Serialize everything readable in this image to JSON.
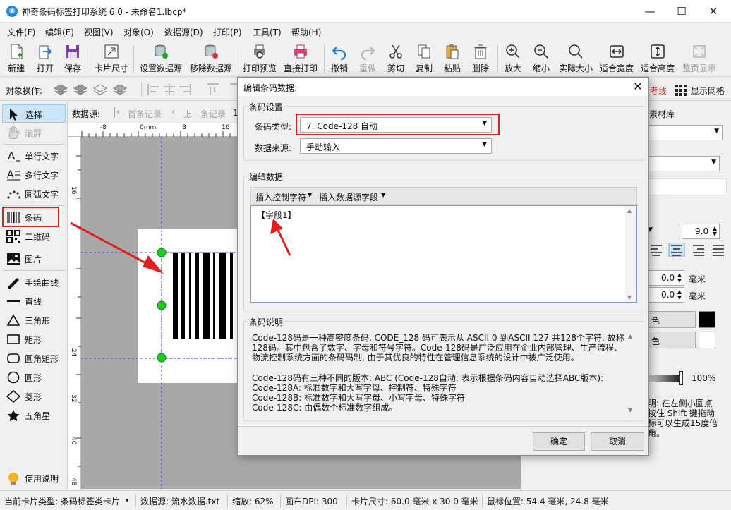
{
  "window": {
    "title": "神奇条码标签打印系统 6.0 - 未命名1.lbcp*",
    "app_icon": "app-logo-icon"
  },
  "menu": [
    "文件(F)",
    "编辑(E)",
    "视图(V)",
    "对象(O)",
    "数据源(D)",
    "打印(P)",
    "工具(T)",
    "帮助(H)"
  ],
  "toolbar": {
    "new": "新建",
    "open": "打开",
    "save": "保存",
    "card_size": "卡片尺寸",
    "set_ds": "设置数据源",
    "remove_ds": "移除数据源",
    "preview": "打印预览",
    "print": "直接打印",
    "undo": "撤销",
    "redo": "重做",
    "cut": "剪切",
    "copy": "复制",
    "paste": "粘贴",
    "delete": "删除",
    "zoom_in": "放大",
    "zoom_out": "缩小",
    "actual": "实际大小",
    "fit_width": "适合宽度",
    "fit_height": "适合高度",
    "fit_page": "整页显示"
  },
  "objbar": {
    "label": "对象操作:",
    "ref_line": "考线",
    "grid": "显示网格"
  },
  "docbar": {
    "ds_label": "数据源:",
    "first": "首条记录",
    "prev": "上一条记录",
    "num": "1"
  },
  "ruler": {
    "h": [
      "-8",
      "0mm",
      "8",
      "16"
    ],
    "v": [
      "16",
      "24",
      "32",
      "40",
      "48"
    ]
  },
  "tools": [
    "选择",
    "滚屏",
    "单行文字",
    "多行文字",
    "圆弧文字",
    "条码",
    "二维码",
    "图片",
    "手绘曲线",
    "直线",
    "三角形",
    "矩形",
    "圆角矩形",
    "圆形",
    "菱形",
    "五角星",
    "使用说明"
  ],
  "right": {
    "tab": "素材库",
    "font_size": "9.0",
    "val1": "0.0",
    "val2": "0.0",
    "unit": "毫米",
    "color_btn": "色",
    "percent": "100%",
    "tip": [
      "明: 在左侧小圆点",
      "按住 Shift 键拖动",
      "标可以生成15度倍",
      "角。"
    ]
  },
  "status": {
    "card_type": "当前卡片类型: 条码标签类卡片",
    "datasource": "数据源: 流水数据.txt",
    "zoom": "缩放: 62%",
    "dpi": "画布DPI: 300",
    "size": "卡片尺寸: 60.0 毫米 x 30.0 毫米",
    "mouse": "鼠标位置: 54.4 毫米, 24.8 毫米"
  },
  "dialog": {
    "title": "编辑条码数据:",
    "settings_label": "条码设置",
    "type_label": "条码类型:",
    "type_value": "7. Code-128 自动",
    "source_label": "数据来源:",
    "source_value": "手动输入",
    "edit_label": "编辑数据",
    "insert_ctrl": "插入控制字符",
    "insert_field": "插入数据源字段",
    "data_value": "【字段1】",
    "desc_label": "条码说明",
    "desc": [
      "Code-128码是一种高密度条码, CODE_128 码可表示从 ASCII 0 到ASCII 127 共128个字符, 故称",
      "128码。其中包含了数字、字母和符号字符。Code-128码是广泛应用在企业内部管理、生产流程、",
      "物流控制系统方面的条码码制, 由于其优良的特性在管理信息系统的设计中被广泛使用。",
      "",
      "Code-128码有三种不同的版本: ABC (Code-128自动: 表示根据条码内容自动选择ABC版本):",
      "Code-128A: 标准数字和大写字母、控制符、特殊字符",
      "Code-128B: 标准数字和大写字母、小写字母、特殊字符",
      "Code-128C: 由偶数个标准数字组成。"
    ],
    "ok": "确定",
    "cancel": "取消"
  },
  "colors": {
    "accent_red": "#e02020",
    "handle_green": "#22cc22"
  }
}
